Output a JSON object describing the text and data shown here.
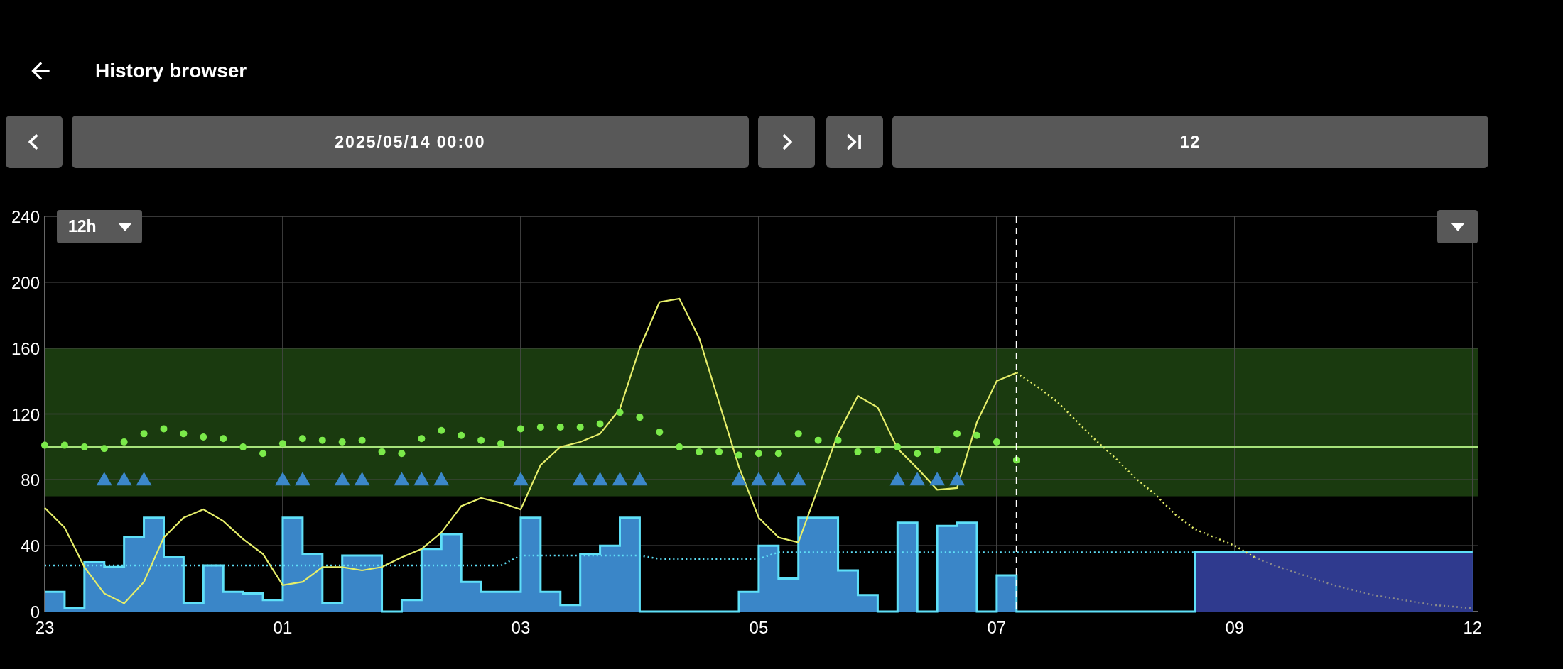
{
  "header": {
    "title": "History browser"
  },
  "navigation": {
    "date": "2025/05/14 00:00",
    "range": "12"
  },
  "chart": {
    "range_selector": "12h",
    "chart_data": {
      "type": "line",
      "categories": [
        "23",
        null,
        null,
        null,
        null,
        null,
        null,
        null,
        null,
        null,
        null,
        null,
        "01",
        null,
        null,
        null,
        null,
        null,
        null,
        null,
        null,
        null,
        null,
        null,
        "03",
        null,
        null,
        null,
        null,
        null,
        null,
        null,
        null,
        null,
        null,
        null,
        "05",
        null,
        null,
        null,
        null,
        null,
        null,
        null,
        null,
        null,
        null,
        null,
        "07",
        null,
        null,
        null,
        null,
        null,
        null,
        null,
        null,
        null,
        null,
        null,
        "09",
        null,
        null,
        null,
        null,
        null,
        null,
        null,
        null,
        null,
        null,
        null,
        "12"
      ],
      "ylim": [
        0,
        240
      ],
      "yticks": [
        0,
        40,
        80,
        120,
        160,
        200,
        240
      ],
      "series": [
        {
          "type": "area",
          "color": "#3a86c8",
          "values": [
            12,
            2,
            30,
            27,
            45,
            57,
            33,
            5,
            28,
            12,
            11,
            7,
            57,
            35,
            5,
            34,
            34,
            0,
            7,
            38,
            47,
            18,
            12,
            12,
            57,
            12,
            4,
            35,
            40,
            57,
            0,
            0,
            0,
            0,
            0,
            12,
            40,
            20,
            57,
            57,
            25,
            10,
            0,
            54,
            0,
            52,
            54,
            0,
            22,
            0,
            0,
            0,
            0,
            0,
            0,
            0,
            0,
            0,
            36,
            36,
            36,
            36,
            36,
            36,
            36,
            36,
            36,
            36,
            36,
            36,
            36,
            36,
            36
          ]
        },
        {
          "type": "area",
          "color": "#2f3a8e",
          "values": [
            null,
            null,
            null,
            null,
            null,
            null,
            null,
            null,
            null,
            null,
            null,
            null,
            null,
            null,
            null,
            null,
            null,
            null,
            null,
            null,
            null,
            null,
            null,
            null,
            null,
            null,
            null,
            null,
            null,
            null,
            null,
            null,
            null,
            null,
            null,
            null,
            null,
            null,
            null,
            null,
            null,
            null,
            null,
            null,
            null,
            null,
            null,
            null,
            null,
            null,
            null,
            null,
            null,
            null,
            null,
            null,
            null,
            null,
            36,
            36,
            36,
            36,
            36,
            36,
            36,
            36,
            36,
            36,
            36,
            36,
            36,
            36,
            36
          ]
        },
        {
          "type": "line",
          "line_style": "dotted",
          "color": "#5fe0f8",
          "values": [
            28,
            28,
            28,
            28,
            28,
            28,
            28,
            28,
            28,
            28,
            28,
            28,
            28,
            28,
            28,
            28,
            28,
            28,
            28,
            28,
            28,
            28,
            28,
            28,
            34,
            34,
            34,
            34,
            34,
            34,
            34,
            32,
            32,
            32,
            32,
            32,
            32,
            36,
            36,
            36,
            36,
            36,
            36,
            36,
            36,
            36,
            36,
            36,
            36,
            36,
            36,
            36,
            36,
            36,
            36,
            36,
            36,
            36,
            36,
            36,
            36,
            36,
            36,
            36,
            36,
            36,
            36,
            36,
            36,
            36,
            36,
            36,
            36
          ]
        },
        {
          "type": "line",
          "line_style": "solid",
          "color": "#e6ee6a",
          "values": [
            63,
            51,
            27,
            11,
            5,
            18,
            45,
            57,
            62,
            55,
            44,
            35,
            16,
            18,
            27,
            27,
            25,
            27,
            33,
            38,
            48,
            64,
            69,
            66,
            62,
            89,
            100,
            103,
            108,
            123,
            160,
            188,
            190,
            166,
            127,
            88,
            57,
            45,
            42,
            75,
            108,
            131,
            124,
            99,
            87,
            74,
            75,
            115,
            140,
            145,
            null,
            null,
            null,
            null,
            null,
            null,
            null,
            null,
            null,
            null,
            null,
            null,
            null,
            null,
            null,
            null,
            null,
            null,
            null,
            null,
            null,
            null,
            null
          ]
        },
        {
          "type": "line",
          "line_style": "dotted",
          "color": "#e6ee6a",
          "values": [
            null,
            null,
            null,
            null,
            null,
            null,
            null,
            null,
            null,
            null,
            null,
            null,
            null,
            null,
            null,
            null,
            null,
            null,
            null,
            null,
            null,
            null,
            null,
            null,
            null,
            null,
            null,
            null,
            null,
            null,
            null,
            null,
            null,
            null,
            null,
            null,
            null,
            null,
            null,
            null,
            null,
            null,
            null,
            null,
            null,
            null,
            null,
            null,
            null,
            145,
            137,
            128,
            116,
            104,
            93,
            81,
            71,
            59,
            50,
            45,
            40,
            33,
            null,
            null,
            null,
            null,
            null,
            null,
            null,
            null,
            null,
            null,
            null
          ]
        },
        {
          "type": "line",
          "line_style": "dotted",
          "color": "#8a8a8a",
          "values": [
            null,
            null,
            null,
            null,
            null,
            null,
            null,
            null,
            null,
            null,
            null,
            null,
            null,
            null,
            null,
            null,
            null,
            null,
            null,
            null,
            null,
            null,
            null,
            null,
            null,
            null,
            null,
            null,
            null,
            null,
            null,
            null,
            null,
            null,
            null,
            null,
            null,
            null,
            null,
            null,
            null,
            null,
            null,
            null,
            null,
            null,
            null,
            null,
            null,
            null,
            null,
            null,
            null,
            null,
            null,
            null,
            null,
            null,
            null,
            null,
            null,
            33,
            28,
            24,
            20,
            16,
            13,
            10,
            8,
            6,
            4,
            3,
            2
          ]
        },
        {
          "type": "scatter",
          "marker": "circle",
          "color": "#7bea4a",
          "values": [
            101,
            101,
            100,
            99,
            103,
            108,
            111,
            108,
            106,
            105,
            100,
            96,
            102,
            105,
            104,
            103,
            104,
            97,
            96,
            105,
            110,
            107,
            104,
            102,
            111,
            112,
            112,
            112,
            114,
            121,
            118,
            109,
            100,
            97,
            97,
            95,
            96,
            96,
            108,
            104,
            104,
            97,
            98,
            100,
            96,
            98,
            108,
            107,
            103,
            92,
            null,
            null,
            null,
            null,
            null,
            null,
            null,
            null,
            null,
            null,
            null,
            null,
            null,
            null,
            null,
            null,
            null,
            null,
            null,
            null,
            null,
            null,
            null
          ]
        },
        {
          "type": "scatter",
          "marker": "triangle",
          "color": "#3b87c9",
          "values": [
            null,
            null,
            null,
            80,
            80,
            80,
            null,
            null,
            null,
            null,
            null,
            null,
            80,
            80,
            null,
            80,
            80,
            null,
            80,
            80,
            80,
            null,
            null,
            null,
            80,
            null,
            null,
            80,
            80,
            80,
            80,
            null,
            null,
            null,
            null,
            80,
            80,
            80,
            80,
            null,
            null,
            null,
            null,
            80,
            80,
            80,
            80,
            null,
            null,
            null,
            null,
            null,
            null,
            null,
            null,
            null,
            null,
            null,
            null,
            null,
            null,
            null,
            null,
            null,
            null,
            null,
            null,
            null,
            null,
            null,
            null,
            null,
            null
          ]
        }
      ],
      "grid": true,
      "bands": [
        {
          "axis": "y",
          "from": 70,
          "to": 160
        }
      ],
      "ref_lines": [
        {
          "axis": "y",
          "value": 100
        }
      ]
    }
  }
}
